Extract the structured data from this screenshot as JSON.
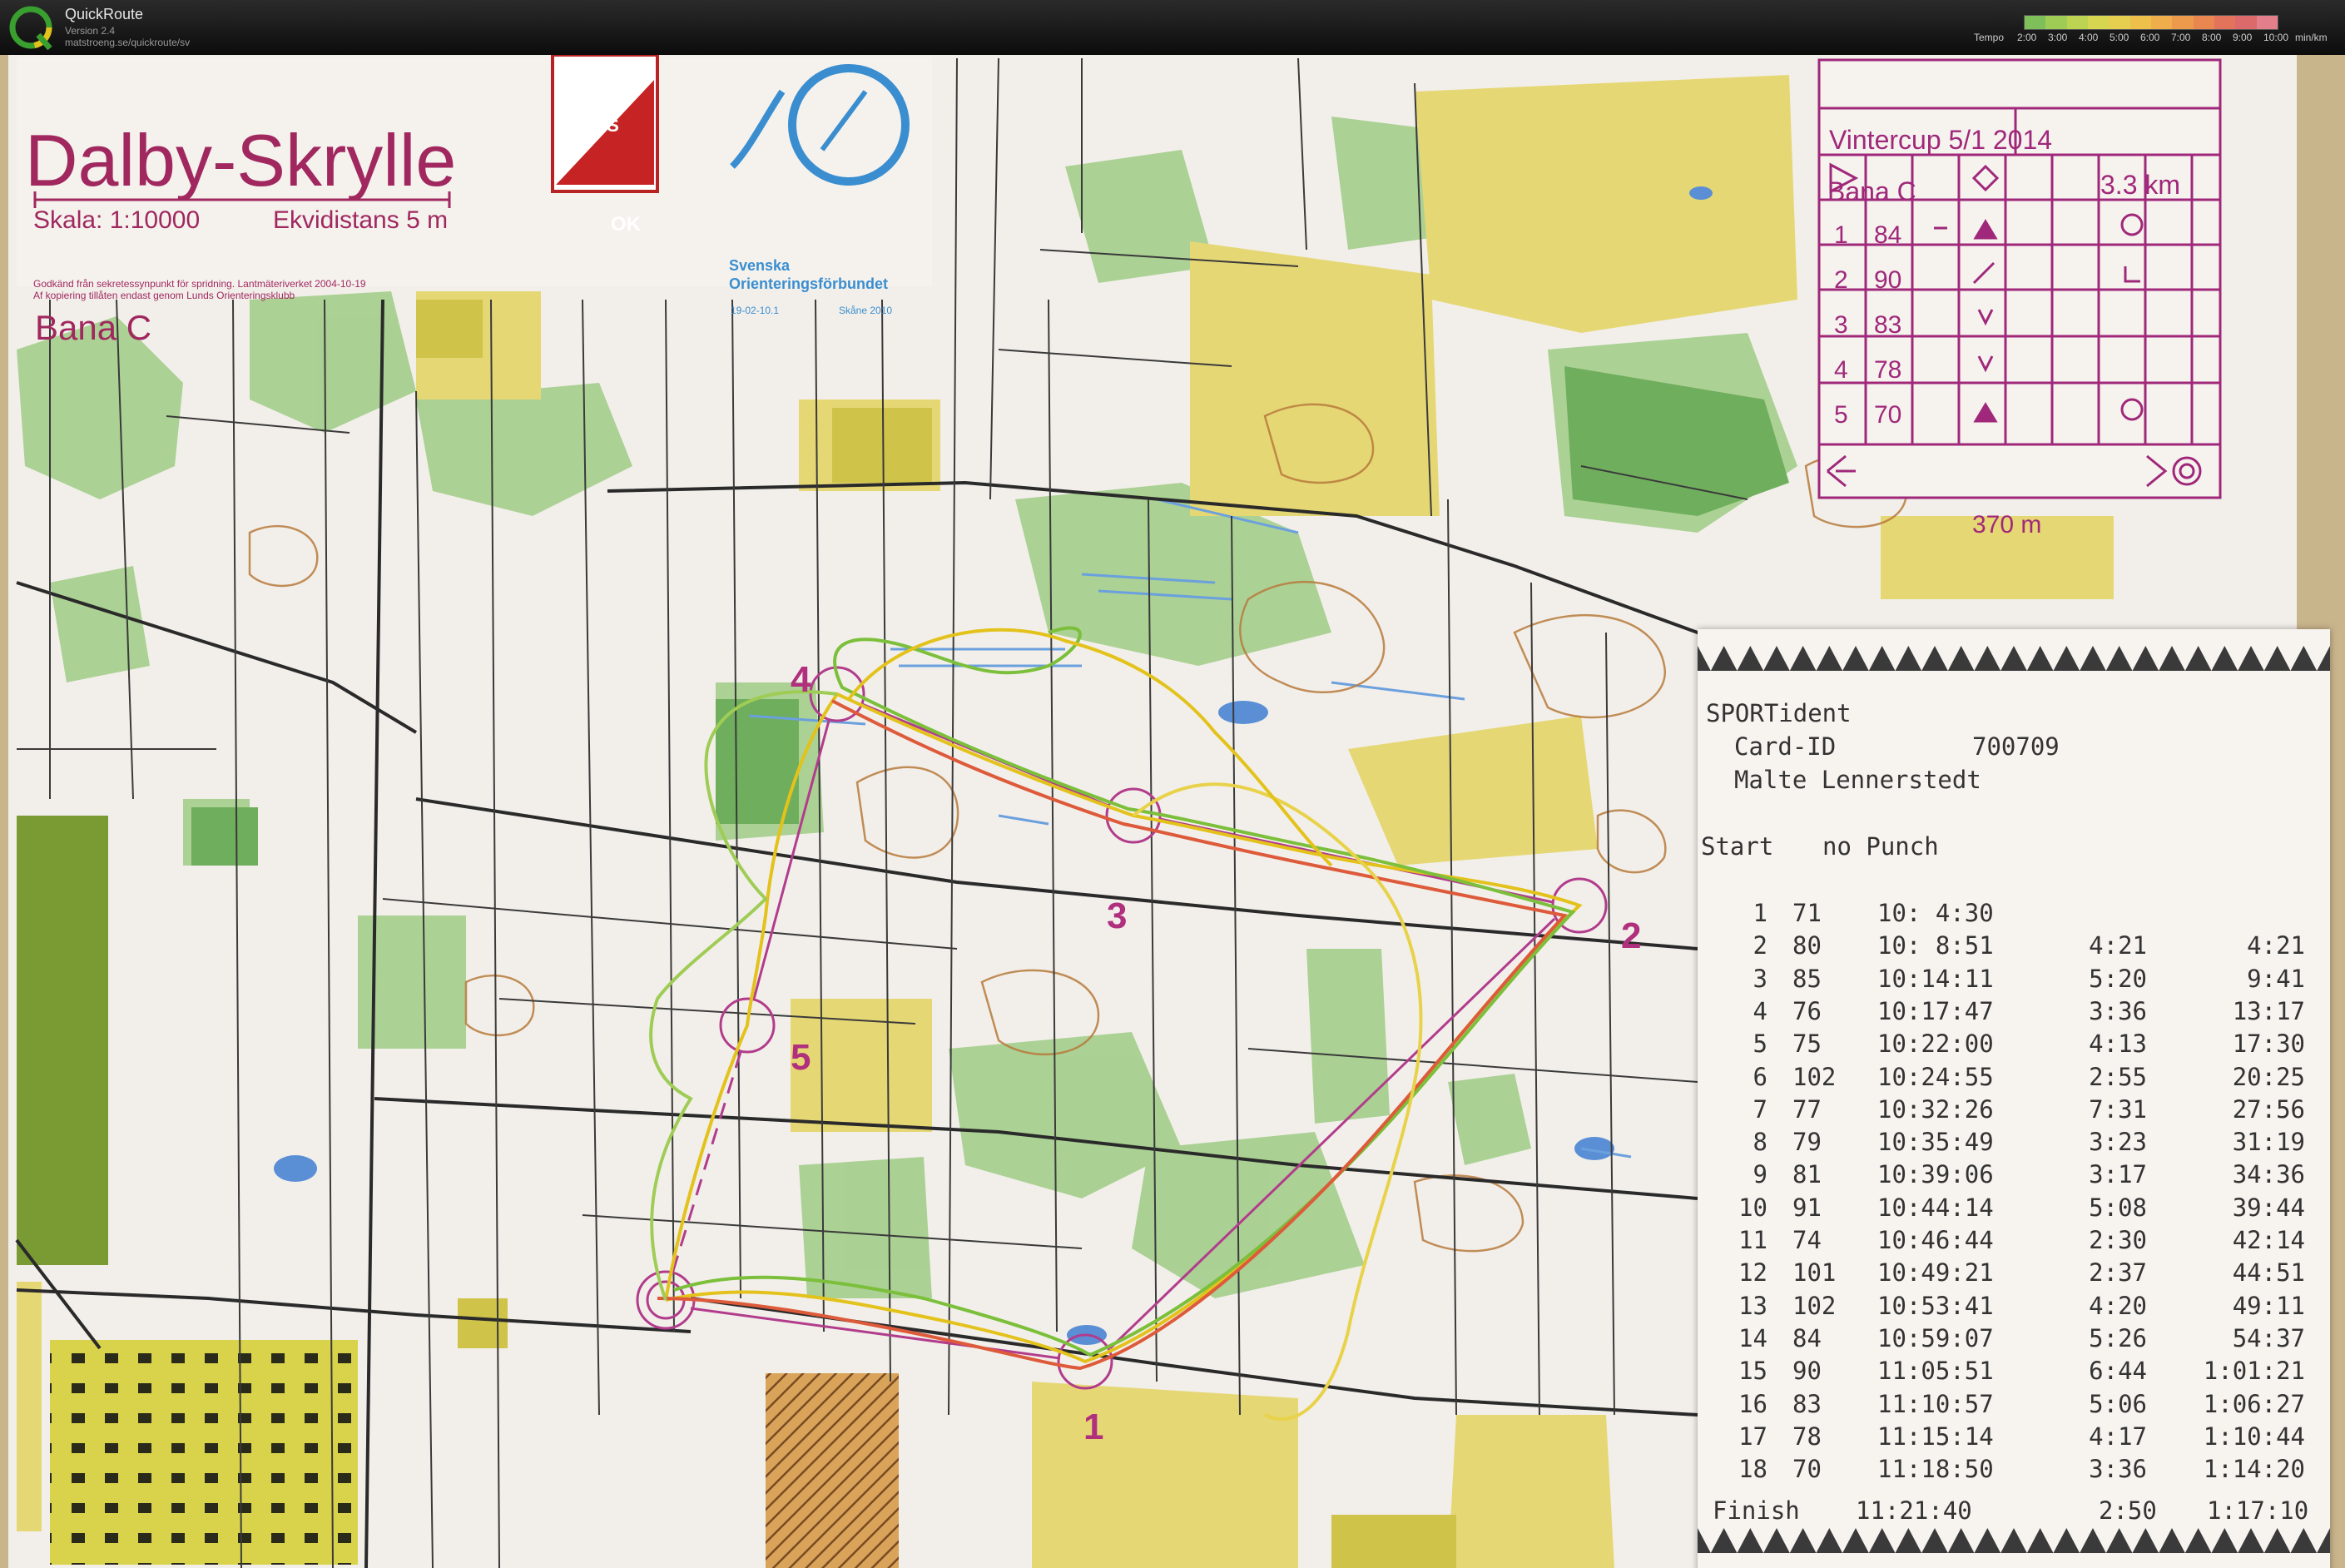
{
  "app": {
    "title": "QuickRoute",
    "version": "Version 2.4",
    "url": "matstroeng.se/quickroute/sv"
  },
  "tempo_legend": {
    "label": "Tempo",
    "ticks": [
      "2:00",
      "3:00",
      "4:00",
      "5:00",
      "6:00",
      "7:00",
      "8:00",
      "9:00",
      "10:00"
    ],
    "unit": "min/km",
    "colors": [
      "#7fbf5a",
      "#9fcc55",
      "#bcd452",
      "#d6d650",
      "#e6cf4e",
      "#edc04c",
      "#efae4b",
      "#ee9a4c",
      "#ea864f",
      "#e3735a",
      "#dd6a6a",
      "#e27f8a"
    ]
  },
  "map": {
    "title": "Dalby-Skrylle",
    "scale": "Skala: 1:10000",
    "contour": "Ekvidistans 5 m",
    "course": "Bana C",
    "fineprint_1": "Godkänd från sekretessynpunkt för spridning. Lantmäteriverket 2004-10-19",
    "fineprint_2": "Af kopiering tillåten endast genom Lunds Orienteringsklubb",
    "club_logo_1": "LUNDS",
    "club_logo_2": "OK",
    "federation": "Svenska Orienteringsförbundet",
    "federation_line1": "Svenska",
    "federation_line2": "Orienteringsförbundet",
    "fed_small_1": "19-02-10.1",
    "fed_small_2": "Skåne 2010",
    "control_labels": [
      "1",
      "2",
      "3",
      "4",
      "5"
    ]
  },
  "control_descriptions": {
    "event": "Vintercup 5/1 2014",
    "course": "Bana C",
    "length": "3.3 km",
    "rows": [
      {
        "n": "1",
        "code": "84"
      },
      {
        "n": "2",
        "code": "90"
      },
      {
        "n": "3",
        "code": "83"
      },
      {
        "n": "4",
        "code": "78"
      },
      {
        "n": "5",
        "code": "70"
      }
    ],
    "finish_distance": "370 m"
  },
  "receipt": {
    "brand": "SPORTident",
    "card_label": "Card-ID",
    "card_id": "700709",
    "runner": "Malte Lennerstedt",
    "start_label": "Start",
    "start_value": "no Punch",
    "splits": [
      {
        "i": "1",
        "code": "71",
        "time": "10: 4:30",
        "leg": "",
        "total": ""
      },
      {
        "i": "2",
        "code": "80",
        "time": "10: 8:51",
        "leg": "4:21",
        "total": "4:21"
      },
      {
        "i": "3",
        "code": "85",
        "time": "10:14:11",
        "leg": "5:20",
        "total": "9:41"
      },
      {
        "i": "4",
        "code": "76",
        "time": "10:17:47",
        "leg": "3:36",
        "total": "13:17"
      },
      {
        "i": "5",
        "code": "75",
        "time": "10:22:00",
        "leg": "4:13",
        "total": "17:30"
      },
      {
        "i": "6",
        "code": "102",
        "time": "10:24:55",
        "leg": "2:55",
        "total": "20:25"
      },
      {
        "i": "7",
        "code": "77",
        "time": "10:32:26",
        "leg": "7:31",
        "total": "27:56"
      },
      {
        "i": "8",
        "code": "79",
        "time": "10:35:49",
        "leg": "3:23",
        "total": "31:19"
      },
      {
        "i": "9",
        "code": "81",
        "time": "10:39:06",
        "leg": "3:17",
        "total": "34:36"
      },
      {
        "i": "10",
        "code": "91",
        "time": "10:44:14",
        "leg": "5:08",
        "total": "39:44"
      },
      {
        "i": "11",
        "code": "74",
        "time": "10:46:44",
        "leg": "2:30",
        "total": "42:14"
      },
      {
        "i": "12",
        "code": "101",
        "time": "10:49:21",
        "leg": "2:37",
        "total": "44:51"
      },
      {
        "i": "13",
        "code": "102",
        "time": "10:53:41",
        "leg": "4:20",
        "total": "49:11"
      },
      {
        "i": "14",
        "code": "84",
        "time": "10:59:07",
        "leg": "5:26",
        "total": "54:37"
      },
      {
        "i": "15",
        "code": "90",
        "time": "11:05:51",
        "leg": "6:44",
        "total": "1:01:21"
      },
      {
        "i": "16",
        "code": "83",
        "time": "11:10:57",
        "leg": "5:06",
        "total": "1:06:27"
      },
      {
        "i": "17",
        "code": "78",
        "time": "11:15:14",
        "leg": "4:17",
        "total": "1:10:44"
      },
      {
        "i": "18",
        "code": "70",
        "time": "11:18:50",
        "leg": "3:36",
        "total": "1:14:20"
      }
    ],
    "finish_label": "Finish",
    "finish_time": "11:21:40",
    "finish_leg": "2:50",
    "finish_total": "1:17:10"
  }
}
